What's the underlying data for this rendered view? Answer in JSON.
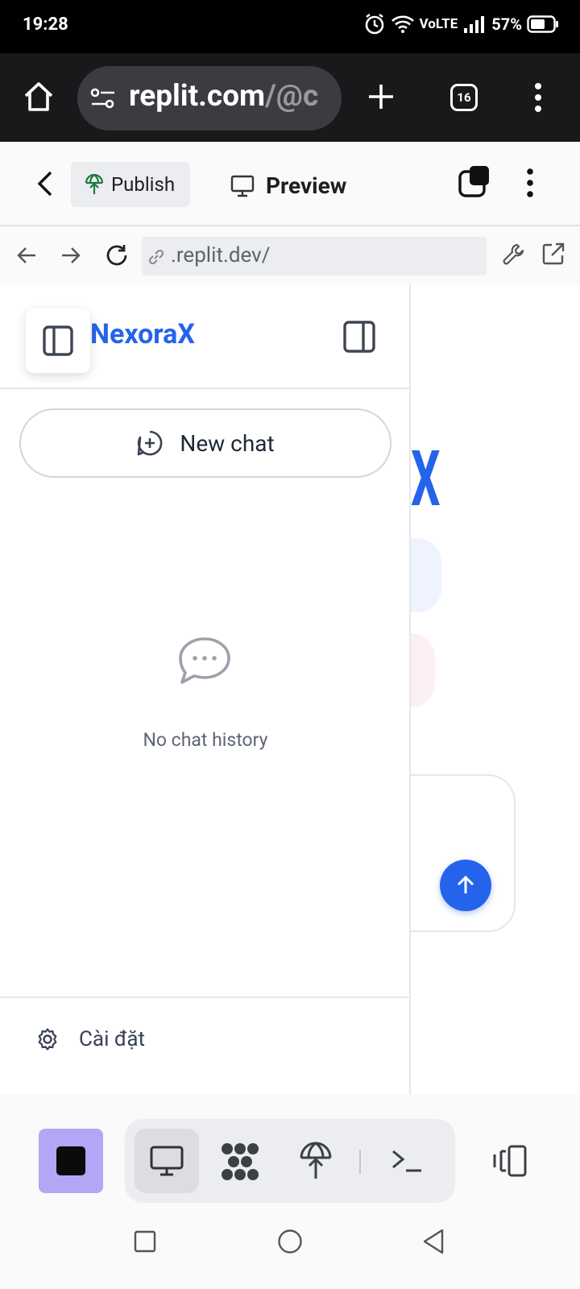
{
  "status_bar": {
    "time": "19:28",
    "network": "VoLTE",
    "battery": "57%",
    "icons": [
      "alarm-icon",
      "wifi-icon",
      "signal-icon",
      "battery-icon"
    ]
  },
  "browser": {
    "url_main": "replit.com",
    "url_rest": "/@c",
    "tab_count": "16",
    "icons": [
      "home-icon",
      "site-settings-icon",
      "new-tab-icon",
      "tabs-icon",
      "menu-icon"
    ]
  },
  "replit_bar": {
    "publish_label": "Publish",
    "preview_label": "Preview"
  },
  "address_bar": {
    "url": ".replit.dev/"
  },
  "sidebar": {
    "brand": "NexoraX",
    "new_chat_label": "New chat",
    "empty_label": "No chat history",
    "settings_label": "Cài đặt"
  },
  "main": {
    "logo_fragment": "X"
  },
  "colors": {
    "accent": "#2563eb",
    "stop_button": "#b4a6f7"
  }
}
